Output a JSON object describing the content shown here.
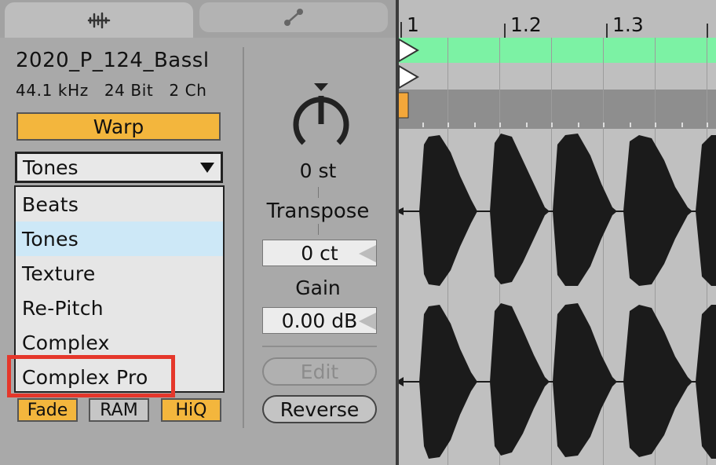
{
  "clip": {
    "name": "2020_P_124_Bassl",
    "sample_rate": "44.1 kHz",
    "bit_depth": "24 Bit",
    "channels": "2 Ch"
  },
  "warp": {
    "label": "Warp",
    "mode_selected": "Tones",
    "modes": [
      "Beats",
      "Tones",
      "Texture",
      "Re-Pitch",
      "Complex",
      "Complex Pro"
    ]
  },
  "toggles": {
    "fade": "Fade",
    "ram": "RAM",
    "hiq": "HiQ"
  },
  "pitch": {
    "transpose_value": "0 st",
    "transpose_label": "Transpose",
    "detune_value": "0 ct"
  },
  "gain": {
    "label": "Gain",
    "value": "0.00 dB"
  },
  "buttons": {
    "edit": "Edit",
    "reverse": "Reverse"
  },
  "ruler": {
    "labels": [
      "1",
      "1.2",
      "1.3"
    ]
  },
  "colors": {
    "accent_orange": "#f3b63d",
    "warp_marker_green": "#7cf2a4",
    "dropdown_selection": "#cde8f7",
    "highlight_red": "#e5372b"
  }
}
